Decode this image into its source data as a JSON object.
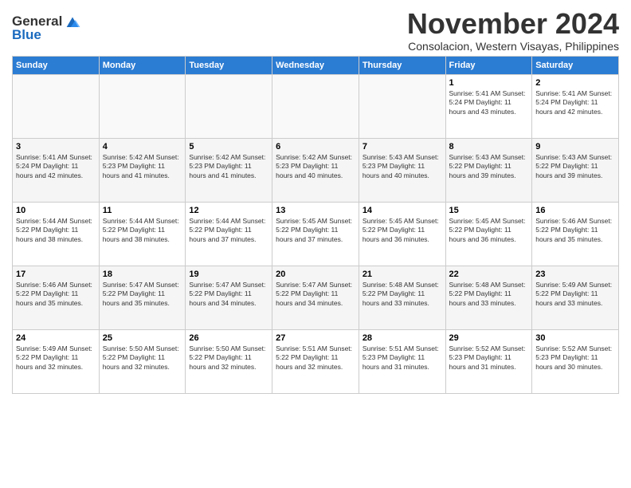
{
  "logo": {
    "general": "General",
    "blue": "Blue"
  },
  "header": {
    "month": "November 2024",
    "location": "Consolacion, Western Visayas, Philippines"
  },
  "weekdays": [
    "Sunday",
    "Monday",
    "Tuesday",
    "Wednesday",
    "Thursday",
    "Friday",
    "Saturday"
  ],
  "weeks": [
    [
      {
        "day": "",
        "info": ""
      },
      {
        "day": "",
        "info": ""
      },
      {
        "day": "",
        "info": ""
      },
      {
        "day": "",
        "info": ""
      },
      {
        "day": "",
        "info": ""
      },
      {
        "day": "1",
        "info": "Sunrise: 5:41 AM\nSunset: 5:24 PM\nDaylight: 11 hours and 43 minutes."
      },
      {
        "day": "2",
        "info": "Sunrise: 5:41 AM\nSunset: 5:24 PM\nDaylight: 11 hours and 42 minutes."
      }
    ],
    [
      {
        "day": "3",
        "info": "Sunrise: 5:41 AM\nSunset: 5:24 PM\nDaylight: 11 hours and 42 minutes."
      },
      {
        "day": "4",
        "info": "Sunrise: 5:42 AM\nSunset: 5:23 PM\nDaylight: 11 hours and 41 minutes."
      },
      {
        "day": "5",
        "info": "Sunrise: 5:42 AM\nSunset: 5:23 PM\nDaylight: 11 hours and 41 minutes."
      },
      {
        "day": "6",
        "info": "Sunrise: 5:42 AM\nSunset: 5:23 PM\nDaylight: 11 hours and 40 minutes."
      },
      {
        "day": "7",
        "info": "Sunrise: 5:43 AM\nSunset: 5:23 PM\nDaylight: 11 hours and 40 minutes."
      },
      {
        "day": "8",
        "info": "Sunrise: 5:43 AM\nSunset: 5:22 PM\nDaylight: 11 hours and 39 minutes."
      },
      {
        "day": "9",
        "info": "Sunrise: 5:43 AM\nSunset: 5:22 PM\nDaylight: 11 hours and 39 minutes."
      }
    ],
    [
      {
        "day": "10",
        "info": "Sunrise: 5:44 AM\nSunset: 5:22 PM\nDaylight: 11 hours and 38 minutes."
      },
      {
        "day": "11",
        "info": "Sunrise: 5:44 AM\nSunset: 5:22 PM\nDaylight: 11 hours and 38 minutes."
      },
      {
        "day": "12",
        "info": "Sunrise: 5:44 AM\nSunset: 5:22 PM\nDaylight: 11 hours and 37 minutes."
      },
      {
        "day": "13",
        "info": "Sunrise: 5:45 AM\nSunset: 5:22 PM\nDaylight: 11 hours and 37 minutes."
      },
      {
        "day": "14",
        "info": "Sunrise: 5:45 AM\nSunset: 5:22 PM\nDaylight: 11 hours and 36 minutes."
      },
      {
        "day": "15",
        "info": "Sunrise: 5:45 AM\nSunset: 5:22 PM\nDaylight: 11 hours and 36 minutes."
      },
      {
        "day": "16",
        "info": "Sunrise: 5:46 AM\nSunset: 5:22 PM\nDaylight: 11 hours and 35 minutes."
      }
    ],
    [
      {
        "day": "17",
        "info": "Sunrise: 5:46 AM\nSunset: 5:22 PM\nDaylight: 11 hours and 35 minutes."
      },
      {
        "day": "18",
        "info": "Sunrise: 5:47 AM\nSunset: 5:22 PM\nDaylight: 11 hours and 35 minutes."
      },
      {
        "day": "19",
        "info": "Sunrise: 5:47 AM\nSunset: 5:22 PM\nDaylight: 11 hours and 34 minutes."
      },
      {
        "day": "20",
        "info": "Sunrise: 5:47 AM\nSunset: 5:22 PM\nDaylight: 11 hours and 34 minutes."
      },
      {
        "day": "21",
        "info": "Sunrise: 5:48 AM\nSunset: 5:22 PM\nDaylight: 11 hours and 33 minutes."
      },
      {
        "day": "22",
        "info": "Sunrise: 5:48 AM\nSunset: 5:22 PM\nDaylight: 11 hours and 33 minutes."
      },
      {
        "day": "23",
        "info": "Sunrise: 5:49 AM\nSunset: 5:22 PM\nDaylight: 11 hours and 33 minutes."
      }
    ],
    [
      {
        "day": "24",
        "info": "Sunrise: 5:49 AM\nSunset: 5:22 PM\nDaylight: 11 hours and 32 minutes."
      },
      {
        "day": "25",
        "info": "Sunrise: 5:50 AM\nSunset: 5:22 PM\nDaylight: 11 hours and 32 minutes."
      },
      {
        "day": "26",
        "info": "Sunrise: 5:50 AM\nSunset: 5:22 PM\nDaylight: 11 hours and 32 minutes."
      },
      {
        "day": "27",
        "info": "Sunrise: 5:51 AM\nSunset: 5:22 PM\nDaylight: 11 hours and 32 minutes."
      },
      {
        "day": "28",
        "info": "Sunrise: 5:51 AM\nSunset: 5:23 PM\nDaylight: 11 hours and 31 minutes."
      },
      {
        "day": "29",
        "info": "Sunrise: 5:52 AM\nSunset: 5:23 PM\nDaylight: 11 hours and 31 minutes."
      },
      {
        "day": "30",
        "info": "Sunrise: 5:52 AM\nSunset: 5:23 PM\nDaylight: 11 hours and 30 minutes."
      }
    ]
  ]
}
